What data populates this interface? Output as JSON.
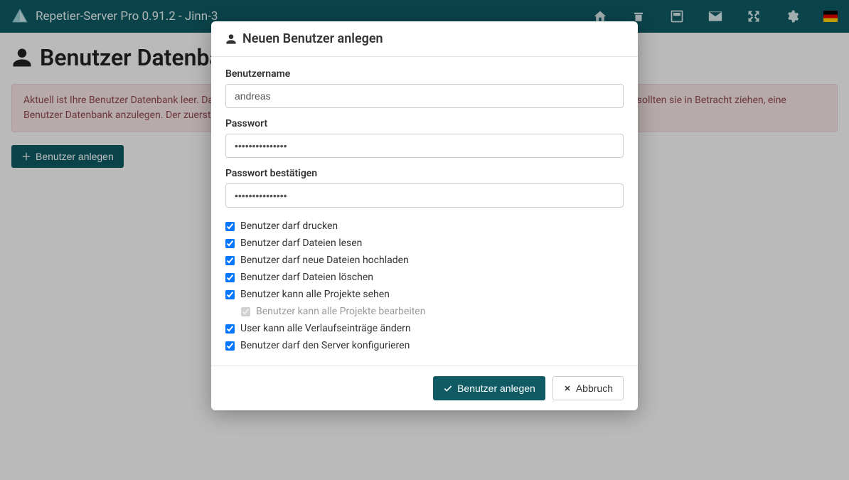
{
  "navbar": {
    "title": "Repetier-Server Pro 0.91.2 - Jinn-3"
  },
  "page": {
    "title": "Benutzer Datenbank",
    "alert": "Aktuell ist Ihre Benutzer Datenbank leer. Das bedeutet, dass jeder die vollständige Kontrolle über den Server hat. Wenn Sie das nicht wollen, sollten sie in Betracht ziehen, eine Benutzer Datenbank anzulegen. Der zuerst angelegte Benutzer muss Admin Rechte haben!",
    "addUserBtn": "Benutzer anlegen"
  },
  "modal": {
    "title": "Neuen Benutzer anlegen",
    "usernameLabel": "Benutzername",
    "usernameValue": "andreas",
    "passwordLabel": "Passwort",
    "passwordValue": "•••••••••••••••",
    "passwordConfirmLabel": "Passwort bestätigen",
    "passwordConfirmValue": "•••••••••••••••",
    "permissions": {
      "print": "Benutzer darf drucken",
      "readFiles": "Benutzer darf Dateien lesen",
      "upload": "Benutzer darf neue Dateien hochladen",
      "delete": "Benutzer darf Dateien löschen",
      "seeProjects": "Benutzer kann alle Projekte sehen",
      "editProjects": "Benutzer kann alle Projekte bearbeiten",
      "editHistory": "User kann alle Verlaufseinträge ändern",
      "configure": "Benutzer darf den Server konfigurieren"
    },
    "submitBtn": "Benutzer anlegen",
    "cancelBtn": "Abbruch"
  }
}
